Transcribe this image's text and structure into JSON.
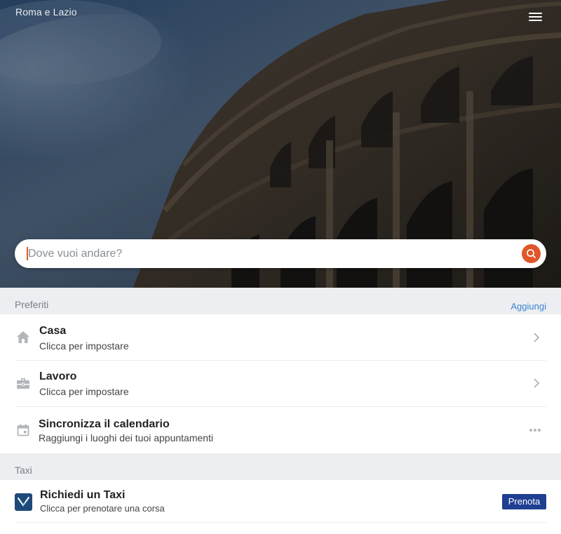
{
  "header": {
    "region": "Roma e Lazio",
    "menu_icon": "hamburger-menu-icon"
  },
  "search": {
    "placeholder": "Dove vuoi andare?",
    "value": "",
    "icon": "search-icon",
    "accent_color": "#e0562a"
  },
  "favorites": {
    "title": "Preferiti",
    "action_label": "Aggiungi",
    "items": [
      {
        "title": "Casa",
        "subtitle": "Clicca per impostare",
        "icon": "home-icon"
      },
      {
        "title": "Lavoro",
        "subtitle": "Clicca per impostare",
        "icon": "briefcase-icon"
      },
      {
        "title": "Sincronizza il calendario",
        "subtitle": "Raggiungi i luoghi dei tuoi appuntamenti",
        "icon": "calendar-icon"
      }
    ]
  },
  "taxi": {
    "title": "Taxi",
    "item": {
      "title": "Richiedi un Taxi",
      "subtitle": "Clicca per prenotare una corsa",
      "icon": "taxi-app-icon",
      "button_label": "Prenota",
      "button_color": "#1f3f92"
    }
  },
  "colors": {
    "section_background": "#eceef1",
    "link": "#3a86d4"
  }
}
